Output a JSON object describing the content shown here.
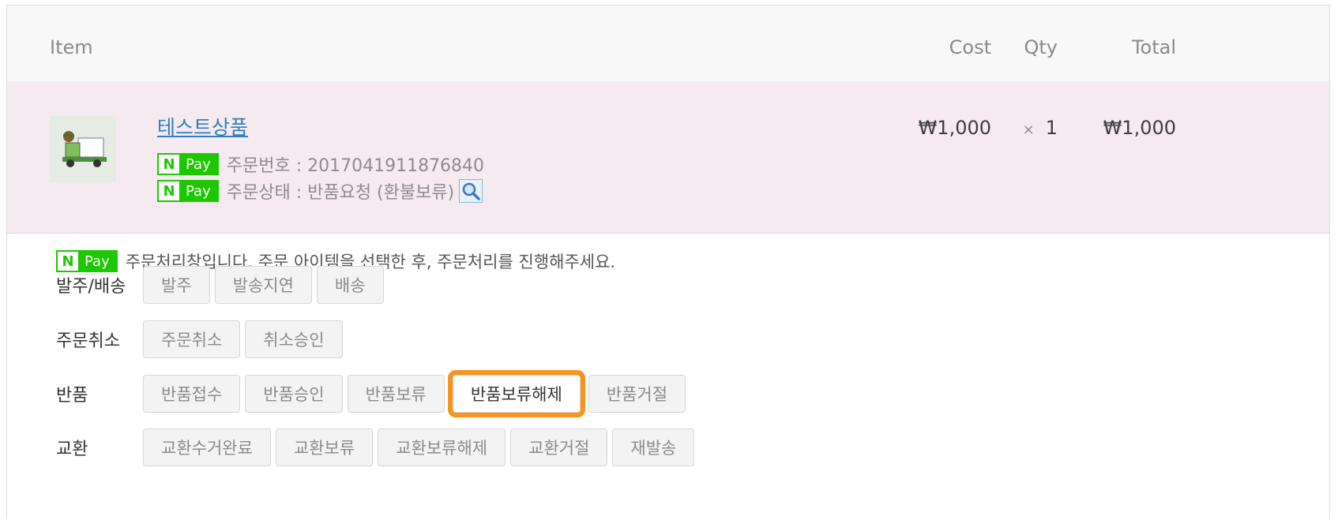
{
  "table_header": {
    "item": "Item",
    "cost": "Cost",
    "qty": "Qty",
    "total": "Total"
  },
  "order_row": {
    "product_name": "테스트상품",
    "npay_n": "N",
    "npay_pay": "Pay",
    "order_number_label": "주문번호 : 2017041911876840",
    "order_status_label": "주문상태 : 반품요청 (환불보류)",
    "cost": "₩1,000",
    "qty_symbol": "×",
    "qty": "1",
    "total": "₩1,000"
  },
  "process": {
    "note": "주문처리창입니다. 주문 아이템을 선택한 후, 주문처리를 진행해주세요.",
    "groups": [
      {
        "label": "발주/배송",
        "buttons": [
          "발주",
          "발송지연",
          "배송"
        ]
      },
      {
        "label": "주문취소",
        "buttons": [
          "주문취소",
          "취소승인"
        ]
      },
      {
        "label": "반품",
        "buttons": [
          "반품접수",
          "반품승인",
          "반품보류",
          "반품보류해제",
          "반품거절"
        ]
      },
      {
        "label": "교환",
        "buttons": [
          "교환수거완료",
          "교환보류",
          "교환보류해제",
          "교환거절",
          "재발송"
        ]
      }
    ]
  },
  "colors": {
    "npay_green": "#1ec800",
    "row_bg": "#f6eaf1",
    "highlight_orange": "#f7931e",
    "link_blue": "#2e7fbd"
  },
  "icons": {
    "thumbnail": "delivery-truck-thumbnail",
    "search": "magnifier-icon"
  }
}
